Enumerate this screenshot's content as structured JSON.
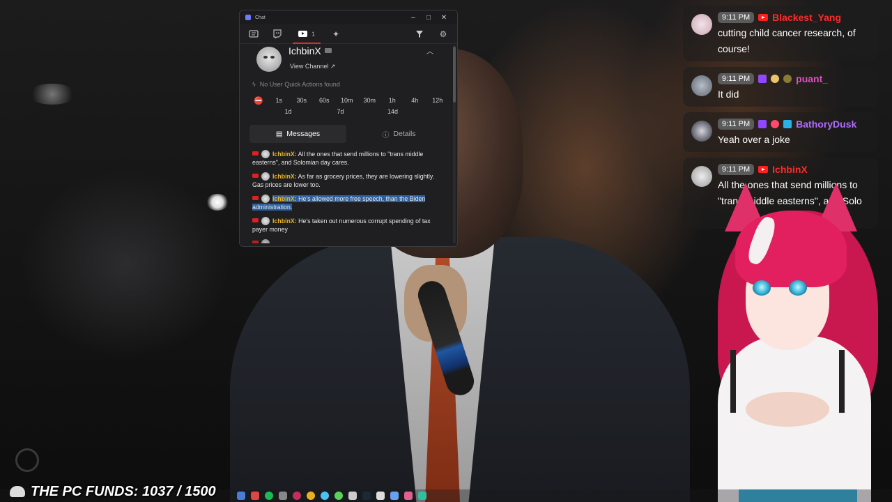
{
  "chat_window": {
    "title": "Chat",
    "toolbar": {
      "youtube_count": "1"
    },
    "user_card": {
      "username": "IchbinX",
      "view_channel": "View Channel ↗",
      "no_quick_actions": "No User Quick Actions found"
    },
    "timeouts_row1": [
      "1s",
      "30s",
      "60s",
      "10m",
      "30m",
      "1h",
      "4h",
      "12h"
    ],
    "timeouts_row2": [
      "1d",
      "7d",
      "14d"
    ],
    "tabs": {
      "messages": "Messages",
      "details": "Details"
    },
    "messages": [
      {
        "user": "IchbinX:",
        "text": " All the ones that send millions to \"trans middle easterns\", and Solomian day cares."
      },
      {
        "user": "IchbinX:",
        "text": " As far as grocery prices, they are lowering slightly. Gas prices are lower too."
      },
      {
        "user": "IchbinX:",
        "text": " He's allowed more free speech, than the Biden administration."
      },
      {
        "user": "IchbinX:",
        "text": " He's taken out numerous corrupt spending of tax payer money"
      }
    ]
  },
  "stream_chat": [
    {
      "time": "9:11 PM",
      "name": "Blackest_Yang",
      "name_color": "#ff2a2a",
      "platform": "youtube",
      "text": "cutting child cancer research, of course!"
    },
    {
      "time": "9:11 PM",
      "name": "puant_",
      "name_color": "#e04fc4",
      "platform": "twitch",
      "text": "It did"
    },
    {
      "time": "9:11 PM",
      "name": "BathoryDusk",
      "name_color": "#b06bff",
      "platform": "twitch",
      "text": "Yeah over a joke"
    },
    {
      "time": "9:11 PM",
      "name": "IchbinX",
      "name_color": "#ff2a2a",
      "platform": "youtube",
      "text": "All the ones that send millions to \"trans middle easterns\", and Solo"
    }
  ],
  "funds_banner": "THE PC FUNDS: 1037 / 1500",
  "colors": {
    "youtube_red": "#e02020",
    "twitch_purple": "#9146ff",
    "username_gold": "#e7b428",
    "selection_blue": "#2d5f9e"
  }
}
